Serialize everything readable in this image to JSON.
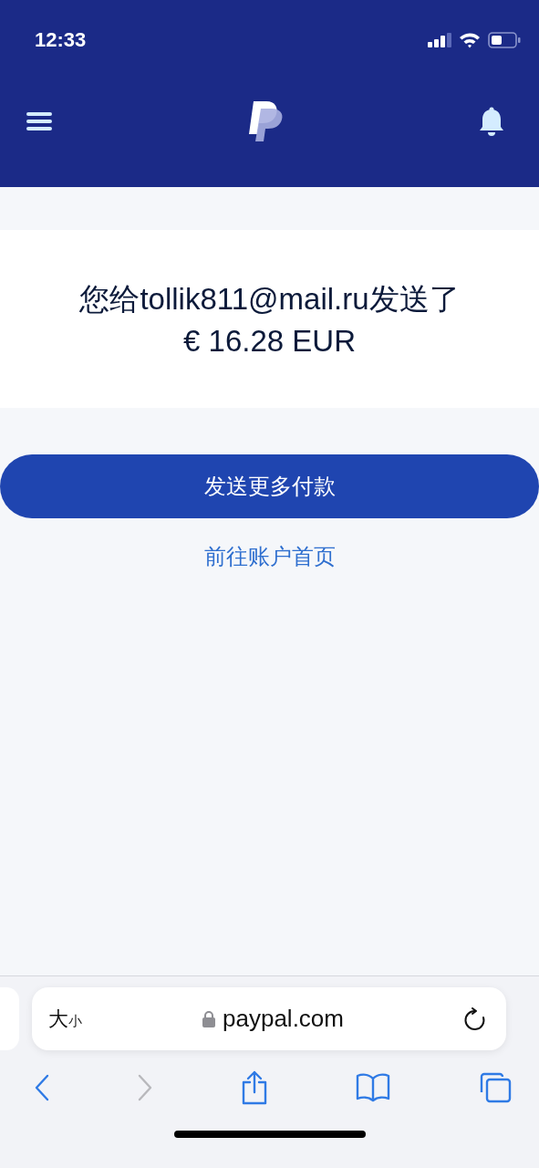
{
  "status_bar": {
    "time": "12:33"
  },
  "confirmation": {
    "message": "您给tollik811@mail.ru发送了",
    "amount": "€ 16.28 EUR"
  },
  "primary_button": {
    "label": "发送更多付款"
  },
  "secondary_link": {
    "label": "前往账户首页"
  },
  "browser": {
    "text_size": {
      "large": "大",
      "small": "小"
    },
    "url": "paypal.com",
    "toolbar": [
      {
        "kind": "back",
        "disabled": false
      },
      {
        "kind": "forward",
        "disabled": true
      },
      {
        "kind": "share",
        "disabled": false
      },
      {
        "kind": "bookmarks",
        "disabled": false
      },
      {
        "kind": "tabs",
        "disabled": false
      }
    ]
  }
}
